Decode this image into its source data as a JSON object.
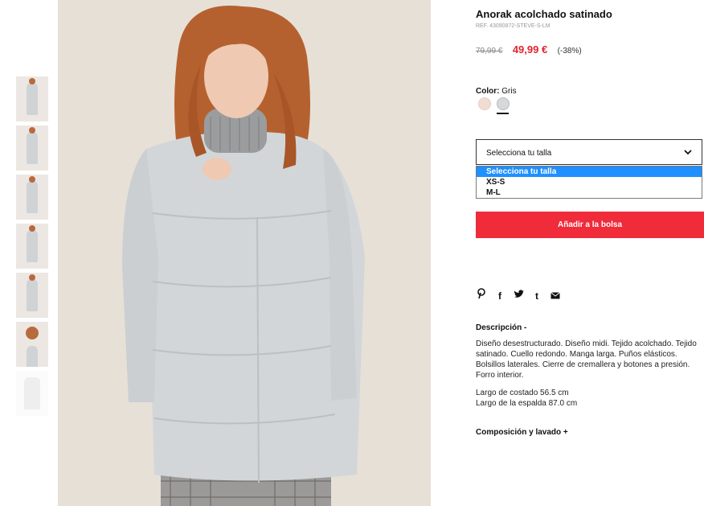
{
  "product": {
    "title": "Anorak acolchado satinado",
    "ref": "REF. 43090872-STEVE-S-LM",
    "old_price": "79,99 €",
    "new_price": "49,99 €",
    "discount": "(-38%)",
    "color_label": "Color:",
    "color_value": "Gris"
  },
  "size": {
    "select_label": "Selecciona tu talla",
    "options": [
      "Selecciona tu talla",
      "XS-S",
      "M-L"
    ],
    "selected_index": 0
  },
  "actions": {
    "add_to_bag": "Añadir a la bolsa"
  },
  "social": [
    {
      "icon": "pinterest-icon",
      "glyph": "℗"
    },
    {
      "icon": "facebook-icon",
      "glyph": "f"
    },
    {
      "icon": "twitter-icon",
      "glyph": "🐦"
    },
    {
      "icon": "tumblr-icon",
      "glyph": "t"
    },
    {
      "icon": "email-icon",
      "glyph": "✉"
    }
  ],
  "description": {
    "heading": "Descripción -",
    "text": "Diseño desestructurado. Diseño midi. Tejido acolchado. Tejido satinado. Cuello redondo. Manga larga. Puños elásticos. Bolsillos laterales. Cierre de cremallera y botones a presión. Forro interior.",
    "measure1": "Largo de costado 56.5 cm",
    "measure2": "Largo de la espalda 87.0 cm"
  },
  "composition": {
    "heading": "Composición y lavado +"
  },
  "colors": {
    "accent_red": "#f02b3a",
    "price_red": "#e12230",
    "dropdown_highlight": "#1e90ff"
  }
}
